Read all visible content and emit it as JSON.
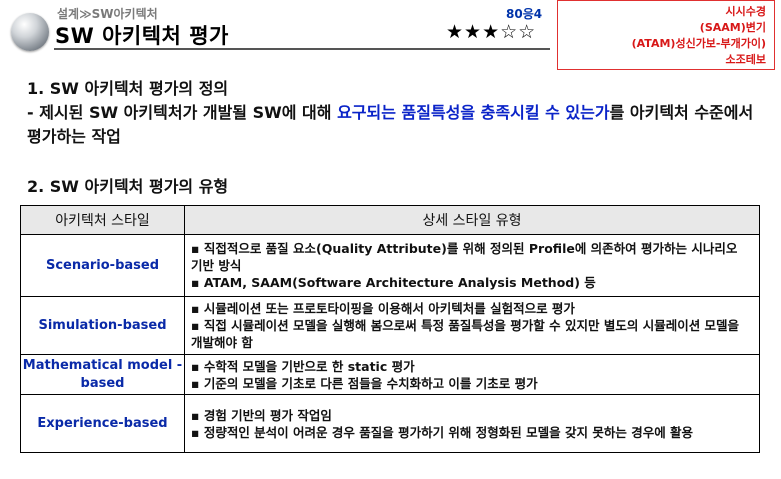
{
  "header": {
    "breadcrumb": "설계≫SW아키텍처",
    "title": "SW 아키텍처 평가",
    "exam_code": "80응4",
    "stars": "★★★☆☆",
    "keywords": [
      "시시수경",
      "(SAAM)변기",
      "(ATAM)성신가보-부개가이)",
      "소조테보"
    ]
  },
  "section1": {
    "title": "1. SW 아키텍처 평가의 정의",
    "body_prefix": "- 제시된 SW 아키텍처가 개발될 SW에 대해 ",
    "body_highlight": "요구되는 품질특성을 충족시킬 수 있는가",
    "body_suffix": "를 아키텍처 수준에서 평가하는 작업"
  },
  "section2": {
    "title": "2. SW 아키텍처 평가의 유형",
    "table": {
      "headers": [
        "아키텍처 스타일",
        "상세 스타일 유형"
      ],
      "rows": [
        {
          "style": "Scenario-based",
          "details": [
            "▪ 직접적으로 품질 요소(Quality Attribute)를 위해 정의된 Profile에 의존하여 평가하는 시나리오 기반 방식",
            "▪ ATAM, SAAM(Software Architecture Analysis Method) 등"
          ]
        },
        {
          "style": "Simulation-based",
          "details": [
            "▪ 시뮬레이션 또는 프로토타이핑을 이용해서 아키텍처를 실험적으로 평가",
            "▪ 직접 시뮬레이션 모델을 실행해 봄으로써 특정 품질특성을 평가할 수 있지만 별도의 시뮬레이션 모델을 개발해야 함"
          ]
        },
        {
          "style": "Mathematical model -based",
          "details": [
            "▪ 수학적 모델을 기반으로 한 static 평가",
            "▪ 기준의 모델을 기초로 다른 점들을 수치화하고 이를 기초로 평가"
          ]
        },
        {
          "style": "Experience-based",
          "details": [
            "▪ 경험 기반의 평가 작업임",
            "▪ 정량적인 분석이 어려운 경우 품질을 평가하기 위해 정형화된 모델을 갖지 못하는 경우에 활용"
          ]
        }
      ]
    }
  }
}
